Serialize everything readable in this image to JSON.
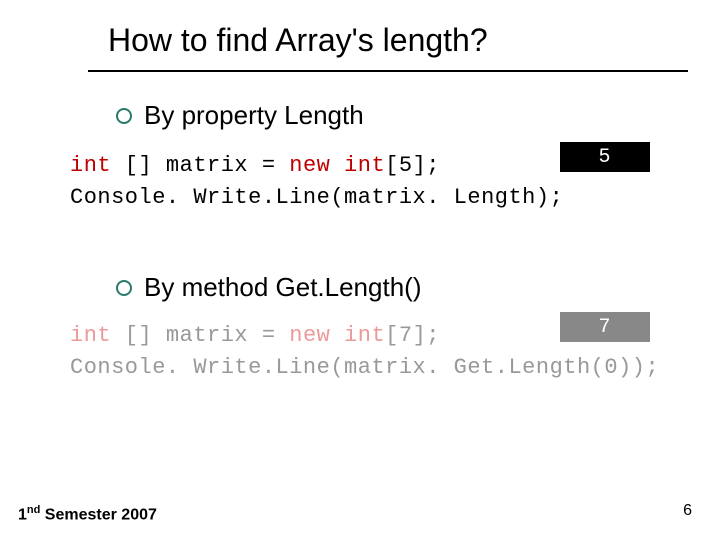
{
  "title": "How to find Array's length?",
  "bullets": {
    "b1": "By property Length",
    "b2": "By method Get.Length()"
  },
  "code1": {
    "kw1": "int",
    "mid1": " [] matrix = ",
    "kw2": "new int",
    "tail1": "[5];",
    "line2": "Console. Write.Line(matrix. Length);"
  },
  "badge1": "5",
  "code2": {
    "kw1": "int",
    "mid1": " [] matrix = ",
    "kw2": "new int",
    "tail1": "[7];",
    "line2": "Console. Write.Line(matrix. Get.Length(0));"
  },
  "badge2": "7",
  "footer": {
    "left_a": "1",
    "left_sup": "nd",
    "left_b": " Semester 2007",
    "right": "6"
  }
}
